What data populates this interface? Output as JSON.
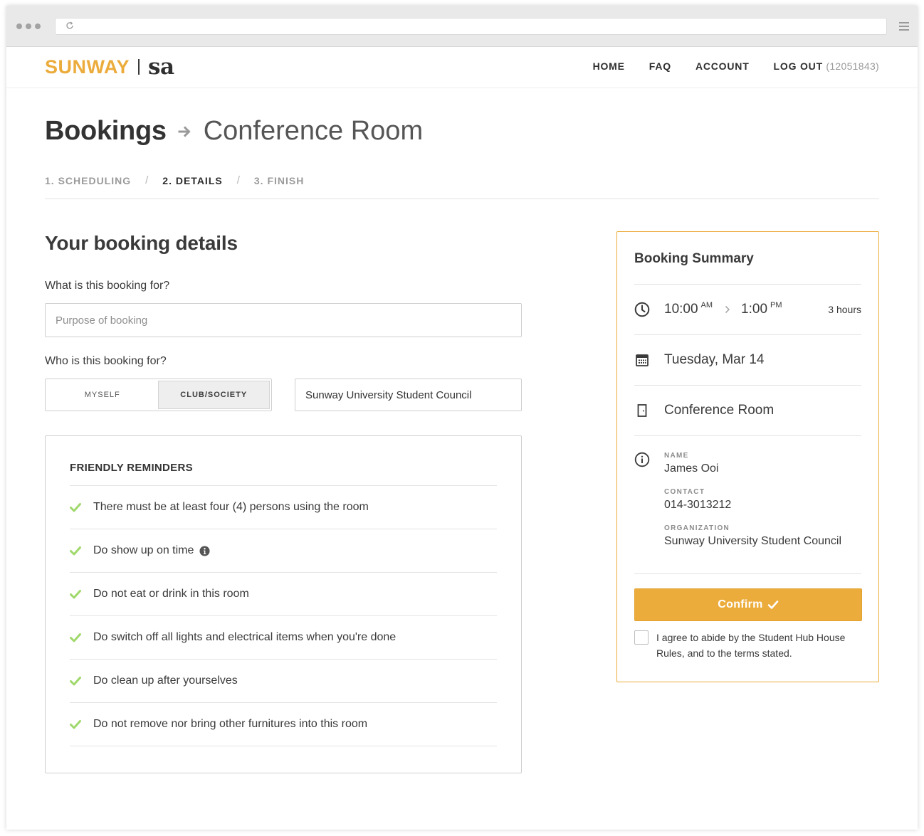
{
  "nav": {
    "logo_primary": "SUNWAY",
    "logo_secondary": "sa",
    "links": [
      "HOME",
      "FAQ",
      "ACCOUNT",
      "LOG OUT"
    ],
    "user_id": "(12051843)"
  },
  "header": {
    "title": "Bookings",
    "subtitle": "Conference Room",
    "steps": [
      "1. SCHEDULING",
      "2. DETAILS",
      "3. FINISH"
    ],
    "active_step": "2. DETAILS"
  },
  "form": {
    "section_title": "Your booking details",
    "purpose_label": "What is this booking for?",
    "purpose_placeholder": "Purpose of booking",
    "purpose_value": "",
    "for_label": "Who is this booking for?",
    "for_options": [
      "MYSELF",
      "CLUB/SOCIETY"
    ],
    "for_selected": "CLUB/SOCIETY",
    "club_value": "Sunway University Student Council"
  },
  "reminders": {
    "title": "FRIENDLY REMINDERS",
    "items": [
      "There must be at least four (4) persons using the room",
      "Do show up on time",
      "Do not eat or drink in this room",
      "Do switch off all lights and electrical items when you're done",
      "Do clean up after yourselves",
      "Do not remove nor bring other furnitures into this room"
    ]
  },
  "summary": {
    "title": "Booking Summary",
    "start_time": "10:00",
    "start_ampm": "AM",
    "end_time": "1:00",
    "end_ampm": "PM",
    "duration": "3 hours",
    "date": "Tuesday, Mar 14",
    "room": "Conference Room",
    "name_label": "NAME",
    "name": "James Ooi",
    "contact_label": "CONTACT",
    "contact": "014-3013212",
    "org_label": "ORGANIZATION",
    "organization": "Sunway University Student Council",
    "confirm_label": "Confirm",
    "agree_text": "I agree to abide by the Student Hub House Rules, and to the terms stated.",
    "agree_checked": false
  },
  "colors": {
    "accent": "#ecac3c",
    "check_green": "#9fd86b",
    "text": "#3a3a3a",
    "muted": "#9a9a9a"
  },
  "icons": {
    "reload": "reload-icon",
    "menu": "hamburger-icon",
    "arrow": "arrow-right-icon",
    "check": "check-icon",
    "info": "info-circle-icon",
    "clock": "clock-icon",
    "calendar": "calendar-icon",
    "door": "door-icon"
  }
}
